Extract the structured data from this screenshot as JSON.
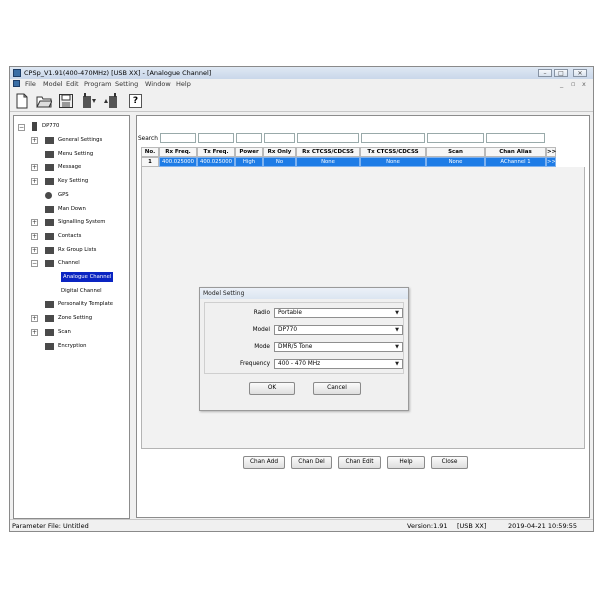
{
  "window": {
    "title": "CPSp_V1.91(400-470MHz) [USB XX] - [Analogue Channel]",
    "controls": [
      "–",
      "□",
      "✕"
    ],
    "mdi_controls": [
      "_",
      "▫",
      "x"
    ]
  },
  "menu": [
    "File",
    "Model",
    "Edit",
    "Program",
    "Setting",
    "Window",
    "Help"
  ],
  "toolbar": {
    "icons": [
      "new-file-icon",
      "open-folder-icon",
      "save-disk-icon",
      "read-radio-icon",
      "write-radio-icon",
      "help-icon"
    ],
    "help_label": "?"
  },
  "tree": {
    "root": "DP770",
    "items": [
      {
        "label": "General Settings",
        "expander": "+",
        "icon": "person-icon"
      },
      {
        "label": "Menu Setting",
        "expander": "",
        "icon": "menu-doc-icon"
      },
      {
        "label": "Message",
        "expander": "+",
        "icon": "message-icon"
      },
      {
        "label": "Key Setting",
        "expander": "+",
        "icon": "keyboard-icon"
      },
      {
        "label": "GPS",
        "expander": "",
        "icon": "gps-icon"
      },
      {
        "label": "Man Down",
        "expander": "",
        "icon": "man-down-icon"
      },
      {
        "label": "Signalling System",
        "expander": "+",
        "icon": "folder-icon"
      },
      {
        "label": "Contacts",
        "expander": "+",
        "icon": "folder-icon"
      },
      {
        "label": "Rx Group Lists",
        "expander": "+",
        "icon": "folder-icon"
      },
      {
        "label": "Channel",
        "expander": "−",
        "icon": "folder-icon"
      },
      {
        "label": "Analogue Channel",
        "expander": "",
        "icon": "",
        "child": true,
        "selected": true
      },
      {
        "label": "Digital Channel",
        "expander": "",
        "icon": "",
        "child": true
      },
      {
        "label": "Personality Template",
        "expander": "",
        "icon": "folder-icon"
      },
      {
        "label": "Zone Setting",
        "expander": "+",
        "icon": "folder-icon"
      },
      {
        "label": "Scan",
        "expander": "+",
        "icon": "folder-icon"
      },
      {
        "label": "Encryption",
        "expander": "",
        "icon": "folder-icon"
      }
    ]
  },
  "search": {
    "label": "Search"
  },
  "table": {
    "headers": [
      "No.",
      "Rx Freq.",
      "Tx Freq.",
      "Power",
      "Rx Only",
      "Rx CTCSS/CDCSS",
      "Tx CTCSS/CDCSS",
      "Scan",
      "Chan Alias",
      ">>"
    ],
    "rows": [
      [
        "1",
        "400.025000",
        "400.025000",
        "High",
        "No",
        "None",
        "None",
        "None",
        "AChannel 1",
        ">>"
      ]
    ]
  },
  "dialog": {
    "title": "Model Setting",
    "fields": [
      {
        "label": "Radio",
        "value": "Portable"
      },
      {
        "label": "Model",
        "value": "DP770"
      },
      {
        "label": "Mode",
        "value": "DMR/5 Tone"
      },
      {
        "label": "Frequency",
        "value": "400 - 470 MHz"
      }
    ],
    "ok": "OK",
    "cancel": "Cancel"
  },
  "buttons": [
    "Chan Add",
    "Chan Del",
    "Chan Edit",
    "Help",
    "Close"
  ],
  "status": {
    "left": "Parameter File: Untitled",
    "version": "Version:1.91",
    "port": "[USB XX]",
    "datetime": "2019-04-21 10:59:55"
  },
  "colors": {
    "selection": "#1e7ce6",
    "tree_selection": "#0a24c2"
  }
}
